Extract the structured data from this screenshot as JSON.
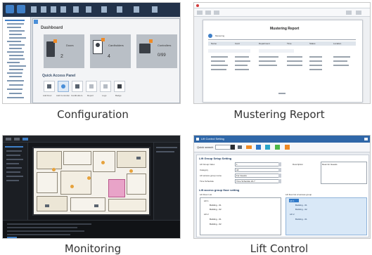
{
  "captions": {
    "configuration": "Configuration",
    "mustering_report": "Mustering Report",
    "monitoring": "Monitoring",
    "lift_control": "Lift Control"
  },
  "configuration": {
    "panel_title": "Dashboard",
    "cards": [
      {
        "icon": "door-icon",
        "label": "Doors",
        "value": "2"
      },
      {
        "icon": "user-badge-icon",
        "label": "Cardholders",
        "value": "4"
      },
      {
        "icon": "controller-icon",
        "label": "Controllers",
        "value": "0/99"
      }
    ],
    "quick_access_title": "Quick Access Panel",
    "quick_items": [
      "Add Door",
      "Add Controller",
      "Cardholders",
      "Report",
      "Logs",
      "Badge"
    ]
  },
  "mustering_report": {
    "title": "Mustering Report",
    "filter_label": "Mustering",
    "table_headers": [
      "Name",
      "Card",
      "Department",
      "Time",
      "Status",
      "Location"
    ]
  },
  "lift_control": {
    "window_title": "Lift Control Setting",
    "search_label": "Quick search",
    "group_section": "Lift Group Setup Setting",
    "fields": [
      {
        "label": "Lift Group Index",
        "value": "1"
      },
      {
        "label": "Category",
        "value": "All"
      },
      {
        "label": "Lift access group name",
        "value": "For Guests"
      },
      {
        "label": "Time Schedule",
        "value": "Time Schedule 24-7"
      }
    ],
    "description_label": "Description",
    "description_value": "Desc for Guests",
    "floor_section": "Lift access group floor setting",
    "floor_list_label": "Lift Floor List",
    "assigned_label": "Lift floor list of access group",
    "tree": [
      {
        "label": "Lift 1",
        "children": [
          "Building - 01",
          "Building - 02"
        ]
      },
      {
        "label": "Lift 2",
        "children": [
          "Building - 01",
          "Building - 02"
        ]
      }
    ],
    "assigned_tree": [
      {
        "label": "Lift 1",
        "children": [
          "Building - 01",
          "Building - 02"
        ]
      },
      {
        "label": "Lift 2",
        "children": [
          "Building - 01"
        ]
      }
    ]
  }
}
